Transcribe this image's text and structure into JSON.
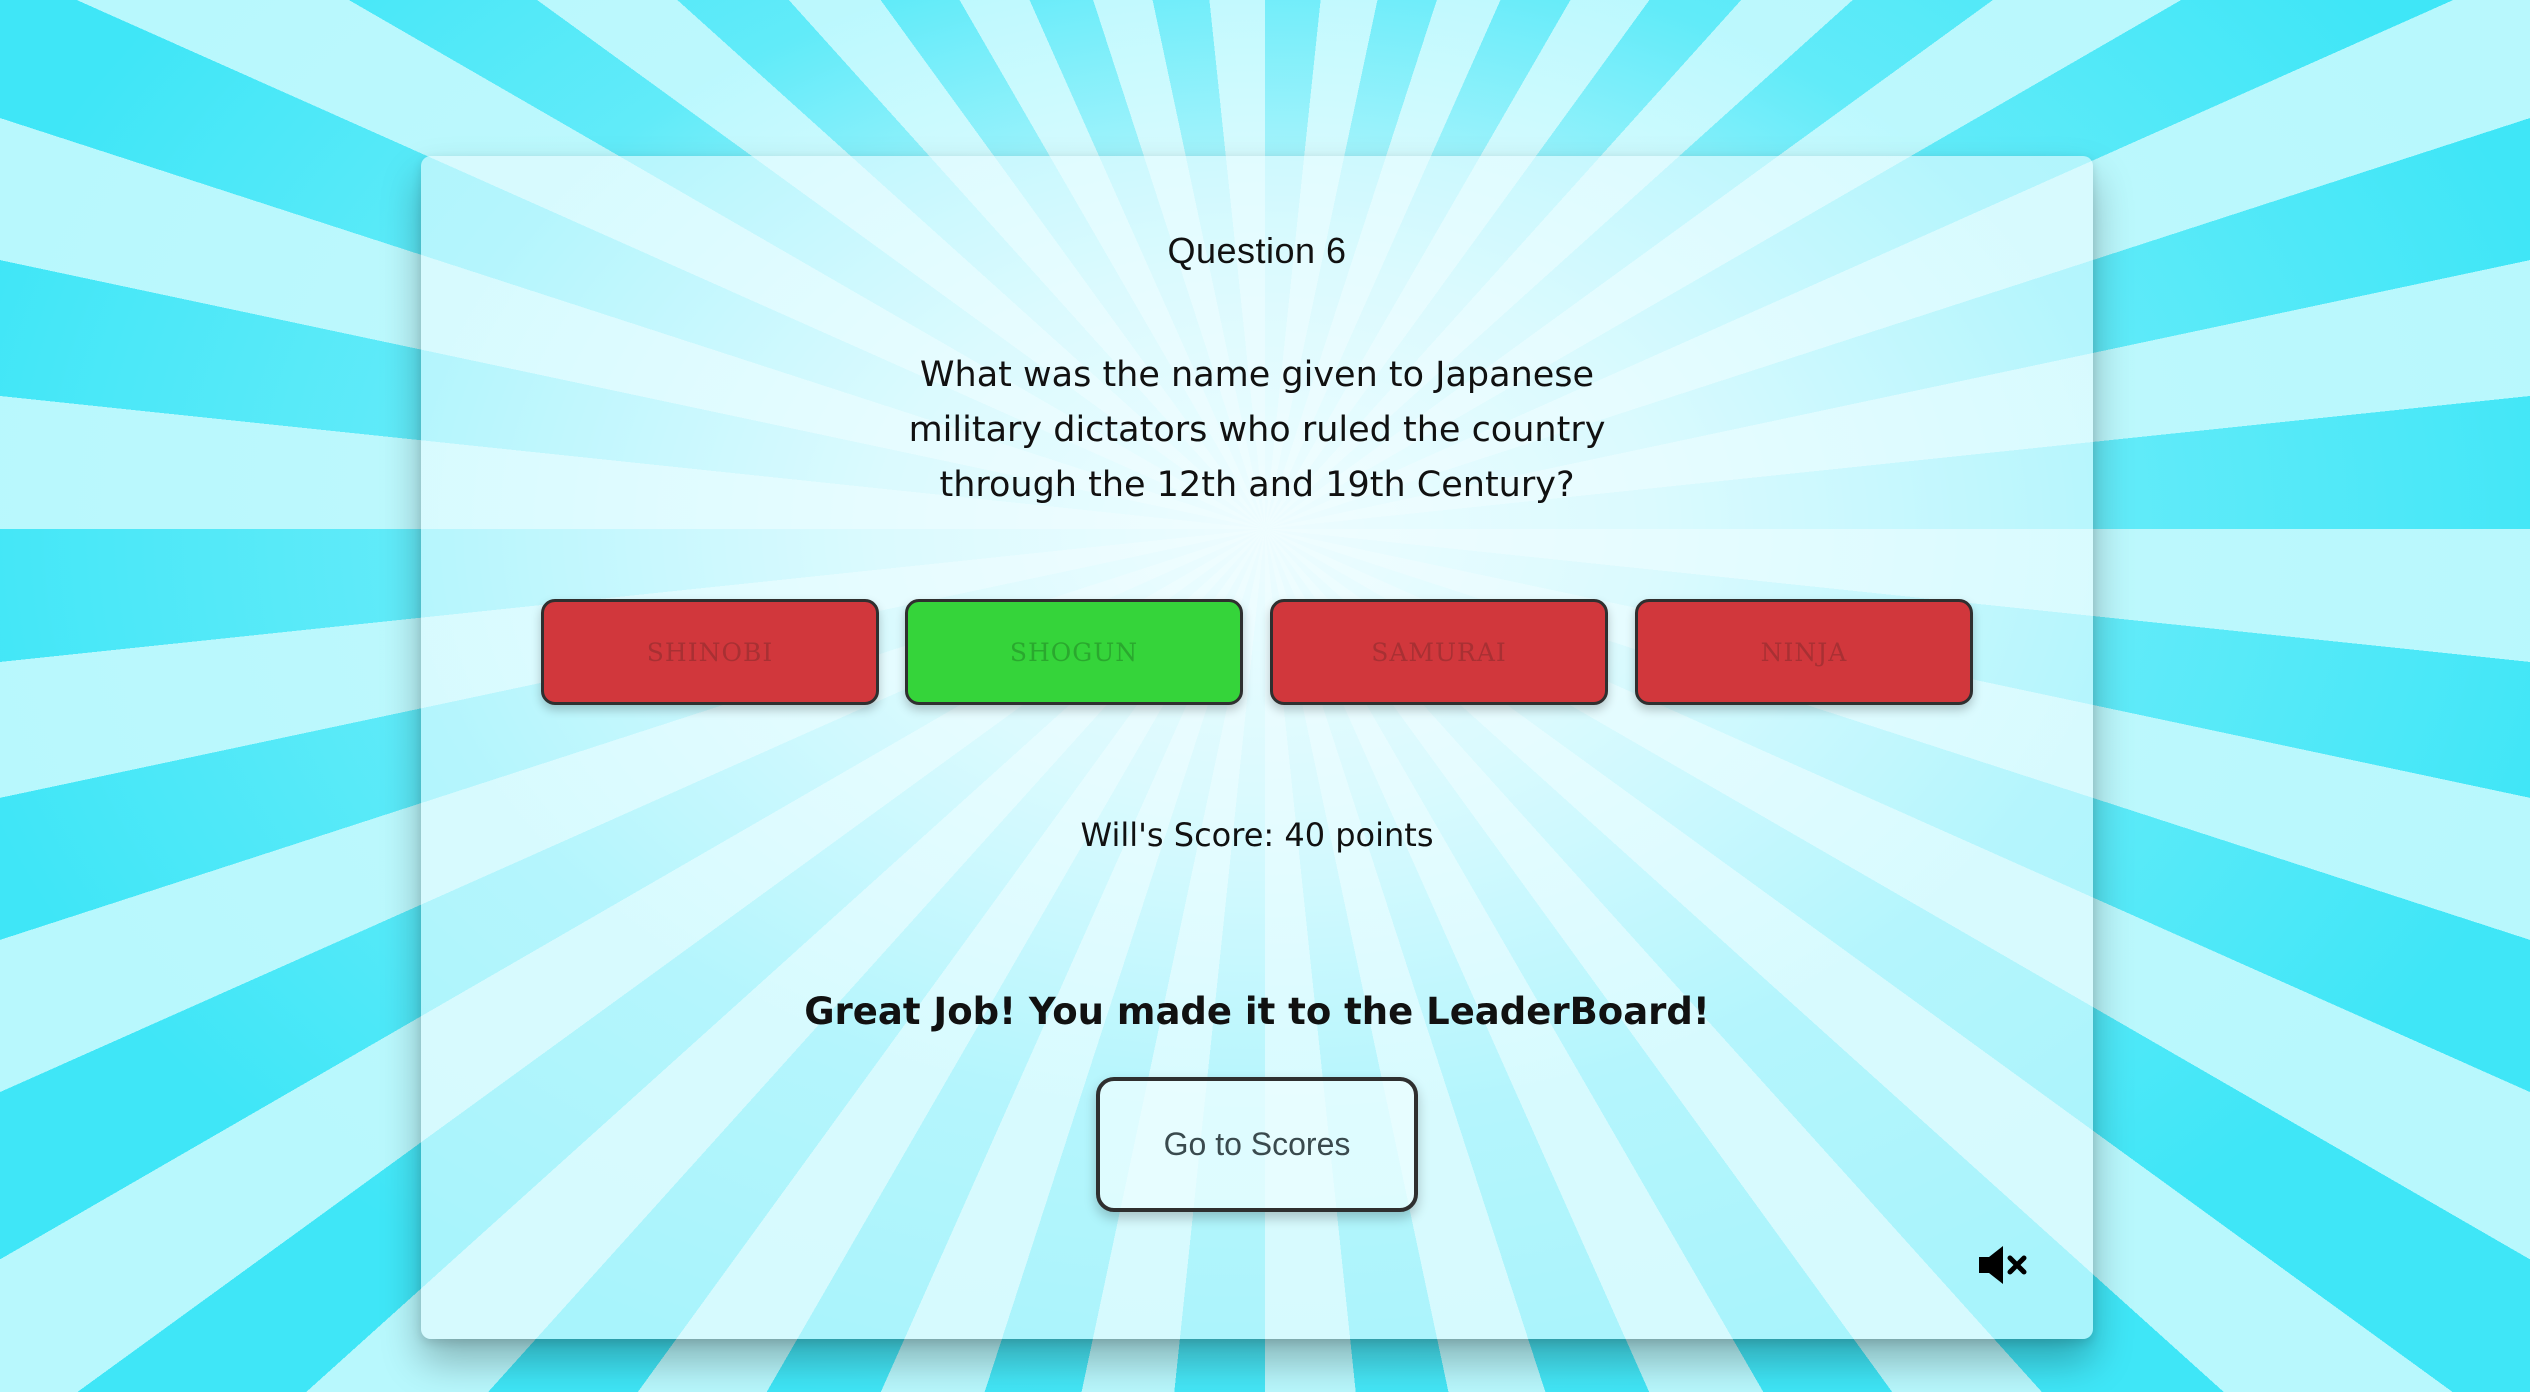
{
  "quiz": {
    "question_label": "Question 6",
    "question_text": "What was the name given to Japanese military dictators who ruled the country through the 12th and 19th Century?",
    "answers": [
      {
        "label": "SHINOBI",
        "status": "wrong",
        "color": "#d1373c"
      },
      {
        "label": "SHOGUN",
        "status": "correct",
        "color": "#35d43a"
      },
      {
        "label": "SAMURAI",
        "status": "wrong",
        "color": "#d1373c"
      },
      {
        "label": "NINJA",
        "status": "wrong",
        "color": "#d1373c"
      }
    ],
    "score_text": "Will's Score: 40 points",
    "leaderboard_message": "Great Job! You made it to the LeaderBoard!",
    "go_to_scores_label": "Go to Scores",
    "sound_icon": "speaker-muted-icon"
  },
  "colors": {
    "background_ray_dark": "#3fe6f7",
    "background_ray_light": "#b8f8fd",
    "wrong_answer": "#d1373c",
    "correct_answer": "#35d43a",
    "button_border": "#2f2f2f"
  }
}
